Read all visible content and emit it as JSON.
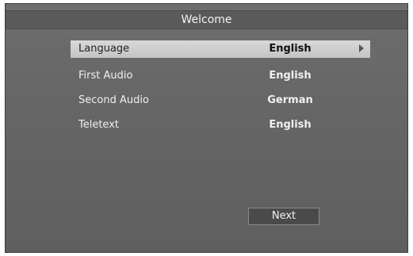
{
  "window": {
    "title": "Welcome"
  },
  "menu": {
    "items": [
      {
        "label": "Language",
        "value": "English"
      },
      {
        "label": "First Audio",
        "value": "English"
      },
      {
        "label": "Second Audio",
        "value": "German"
      },
      {
        "label": "Teletext",
        "value": "English"
      }
    ]
  },
  "actions": {
    "next_label": "Next"
  },
  "icons": {
    "selection_arrow": "chevron-right-icon"
  }
}
